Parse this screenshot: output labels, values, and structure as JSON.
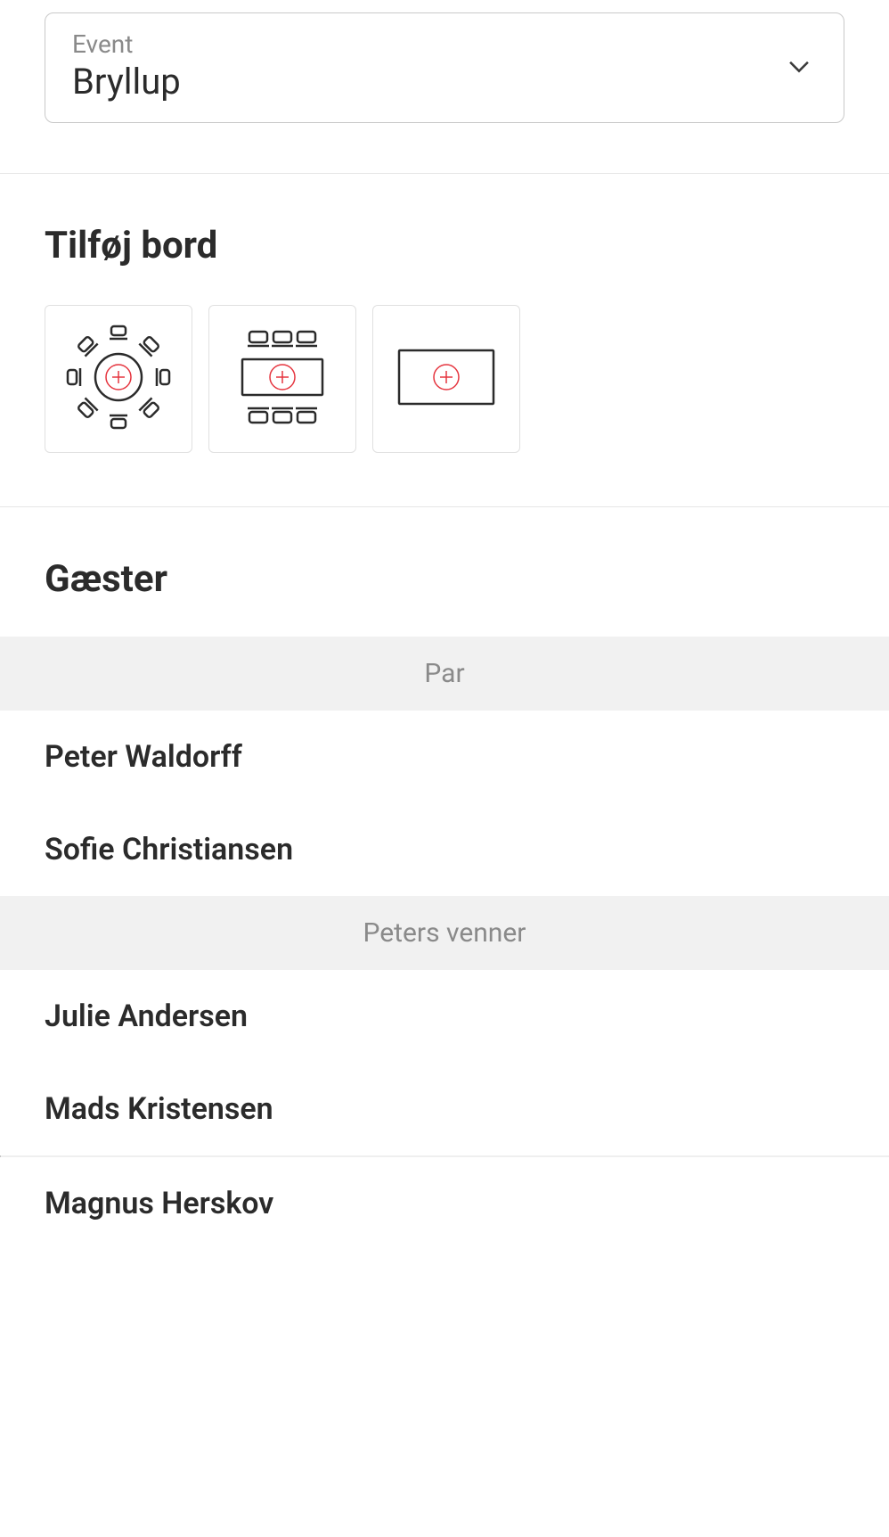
{
  "event_select": {
    "label": "Event",
    "value": "Bryllup"
  },
  "add_table": {
    "title": "Tilføj bord",
    "options": [
      {
        "name": "round-table",
        "icon": "round-table-icon"
      },
      {
        "name": "rect-table-seated",
        "icon": "rect-table-seated-icon"
      },
      {
        "name": "rect-table-empty",
        "icon": "rect-table-empty-icon"
      }
    ]
  },
  "guests": {
    "title": "Gæster",
    "groups": [
      {
        "name": "Par",
        "members": [
          "Peter Waldorff",
          "Sofie Christiansen"
        ]
      },
      {
        "name": "Peters venner",
        "members": [
          "Julie Andersen",
          "Mads Kristensen",
          "Magnus Herskov"
        ]
      }
    ]
  }
}
